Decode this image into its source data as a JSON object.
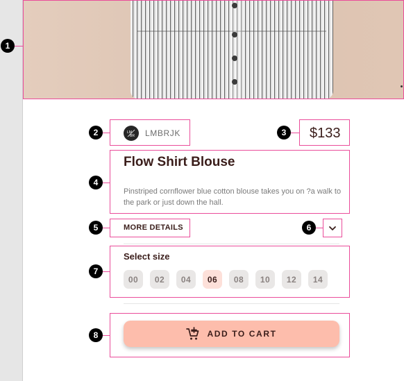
{
  "product": {
    "brand": "LMBRJK",
    "price": "$133",
    "title": "Flow Shirt Blouse",
    "description": "Pinstriped cornflower blue cotton blouse takes you on ?a walk to the park or just down the hall.",
    "more_details_label": "MORE DETAILS"
  },
  "size_selector": {
    "label": "Select size",
    "options": [
      "00",
      "02",
      "04",
      "06",
      "08",
      "10",
      "12",
      "14"
    ],
    "selected": "06"
  },
  "cart": {
    "add_label": "ADD TO CART"
  },
  "annotations": [
    "1",
    "2",
    "3",
    "4",
    "5",
    "6",
    "7",
    "8"
  ],
  "colors": {
    "accent": "#fdbdac",
    "highlight": "#ea4c9a",
    "text": "#3a1d1a"
  }
}
